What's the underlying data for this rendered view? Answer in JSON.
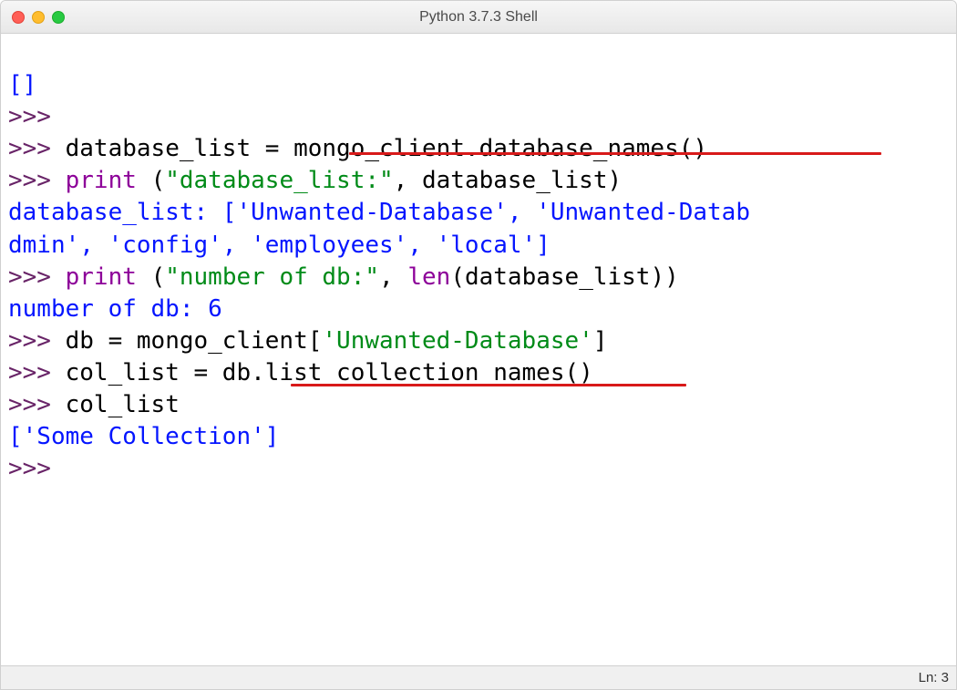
{
  "window": {
    "title": "Python 3.7.3 Shell"
  },
  "shell": {
    "line0": "[]",
    "prompt": ">>> ",
    "emptyPrompt": ">>>",
    "line1_code": "database_list = mongo_client.database_names()",
    "line2_print": "print",
    "line2_space": " ",
    "line2_paren_open": "(",
    "line2_string": "\"database_list:\"",
    "line2_rest": ", database_list)",
    "line3_out": "database_list: ['Unwanted-Database', 'Unwanted-Datab",
    "line4_out": "dmin', 'config', 'employees', 'local']",
    "line5_print": "print",
    "line5_space": " ",
    "line5_paren_open": "(",
    "line5_string": "\"number of db:\"",
    "line5_mid": ", ",
    "line5_len": "len",
    "line5_rest": "(database_list))",
    "line6_out": "number of db: 6",
    "line7_pre": "db = mongo_client[",
    "line7_string": "'Unwanted-Database'",
    "line7_post": "]",
    "line8_code": "col_list = db.list_collection_names()",
    "line9_code": "col_list",
    "line10_out": "['Some Collection']"
  },
  "status": {
    "text": "Ln: 3"
  }
}
